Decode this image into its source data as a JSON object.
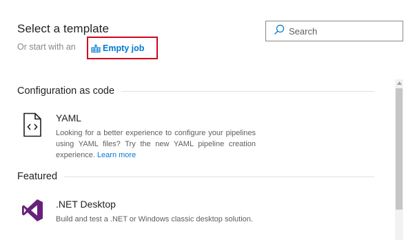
{
  "header": {
    "title": "Select a template",
    "subtitle": "Or start with an",
    "empty_job_label": "Empty job",
    "empty_job_icon": "empty-job-icon"
  },
  "search": {
    "placeholder": "Search",
    "value": "",
    "icon": "search-icon"
  },
  "sections": [
    {
      "title": "Configuration as code",
      "items": [
        {
          "name": "YAML",
          "icon": "yaml-file-icon",
          "description": "Looking for a better experience to configure your pipelines using YAML files? Try the new YAML pipeline creation experience.",
          "link": "Learn more"
        }
      ]
    },
    {
      "title": "Featured",
      "items": [
        {
          "name": ".NET Desktop",
          "icon": "visual-studio-icon",
          "description": "Build and test a .NET or Windows classic desktop solution."
        }
      ]
    }
  ],
  "colors": {
    "accent": "#0078d4",
    "highlight_border": "#d0021b",
    "visual_studio": "#68217a"
  }
}
